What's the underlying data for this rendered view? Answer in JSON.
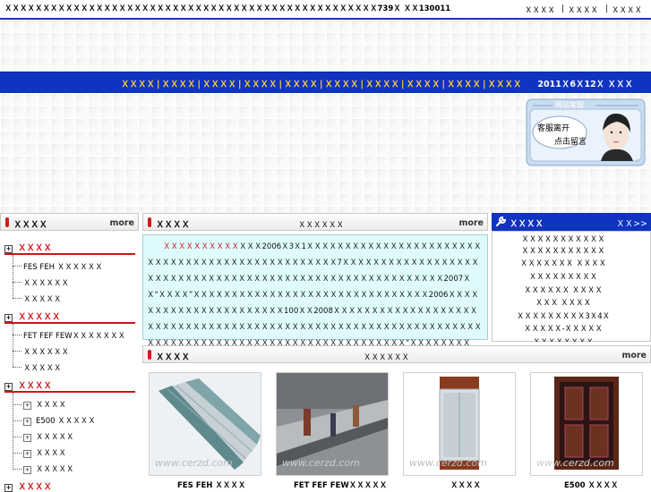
{
  "topbar": {
    "address": "ＸＸＸＸＸＸＸＸＸＸＸＸＸＸＸＸＸＸＸＸＸＸＸＸＸＸＸＸＸＸＸＸＸＸＸＸＸＸＸＸＸＸＸＸＸＸＸＸＸ739Ｘ ＸＸ130011",
    "links": [
      "ＸＸＸＸ",
      "ＸＸＸＸ",
      "ＸＸＸＸ"
    ]
  },
  "nav": {
    "items": [
      "ＸＸＸＸ",
      "ＸＸＸＸ",
      "ＸＸＸＸ",
      "ＸＸＸＸ",
      "ＸＸＸＸ",
      "ＸＸＸＸ",
      "ＸＸＸＸ",
      "ＸＸＸＸ",
      "ＸＸＸＸ",
      "ＸＸＸＸ"
    ],
    "date": "2011Ｘ6Ｘ12Ｘ ＸＸＸ"
  },
  "chat": {
    "title": "网站客服",
    "status": "客服离开",
    "action": "点击留言"
  },
  "sidebar": {
    "title": "ＸＸＸＸ",
    "more": "more",
    "categories": [
      {
        "label": "ＸＸＸＸ",
        "items": [
          "FES FEH ＸＸＸＸＸＸ",
          "ＸＸＸＸＸＸ",
          "ＸＸＸＸＸ"
        ]
      },
      {
        "label": "ＸＸＸＸＸ",
        "items": [
          "FET FEF FEWＸＸＸＸＸＸＸ",
          "ＸＸＸＸＸＸ",
          "ＸＸＸＸＸ"
        ]
      },
      {
        "label": "ＸＸＸＸ",
        "items": [
          "ＸＸＸＸ",
          "E500 ＸＸＸＸＸ",
          "ＸＸＸＸＸ",
          "ＸＸＸＸ",
          "ＸＸＸＸＸ"
        ]
      },
      {
        "label": "ＸＸＸＸ",
        "items": []
      }
    ]
  },
  "intro": {
    "title": "ＸＸＸＸ",
    "subtitle": "ＸＸＸＸＸＸ",
    "more": "more",
    "lead": "ＸＸＸＸＸＸＸＸＸＸ",
    "text": "ＸＸＸ2006Ｘ3Ｘ1ＸＸＸＸＸＸＸＸＸＸＸＸＸＸＸＸＸＸＸＸＸＸＸＸＸＸＸＸＸＸＸＸＸＸＸＸＸＸＸＸＸＸＸＸＸＸＸＸ7ＸＸＸＸＸＸＸＸＸＸＸＸＸＸＸＸＸＸＸＸＸＸＸＸＸＸＸＸＸＸＸＸＸＸＸＸＸＸＸＸＸＸＸＸＸＸＸＸＸＸＸＸＸＸＸＸＸ2007ＸＸ“ＸＸＸＸ”ＸＸＸＸＸＸＸＸＸＸＸＸＸＸＸＸＸＸＸＸＸＸＸＸＸＸＸＸＸＸＸ2006ＸＸＸＸＸＸＸＸＸＸＸＸＸＸＸＸＸＸＸＸＸＸ100ＸＸ2008ＸＸＸＸＸＸＸＸＸＸＸＸＸＸＸＸＸＸＸＸＸＸＸＸＸＸＸＸＸＸＸＸＸＸＸＸＸＸＸＸＸＸＸＸＸＸＸＸＸＸＸＸＸＸＸＸＸＸＸＸＸＸＸＸＸＸＸＸＸＸＸＸＸＸＸＸＸＸＸＸＸＸＸＸＸＸＸＸＸＸＸＸＸＸＸＸＸ“ＸＸＸＸＸＸＸＸＸ”ＸＸＸ……ＸＸＸＸ"
  },
  "service": {
    "title": "ＸＸＸＸ",
    "more": "ＸＸ>>",
    "lines": [
      "ＸＸＸＸＸＸＸＸＸＸＸ",
      "ＸＸＸＸＸＸＸＸＸＸＸ",
      "ＸＸＸＸＸＸＸ ＸＸＸＸ",
      "ＸＸＸＸＸＸＸＸＸ",
      "ＸＸＸＸＸＸ  ＸＸＸＸ",
      "ＸＸＸ ＸＸＸＸ",
      "ＸＸＸＸＸＸＸＸＸ3Ｘ4Ｘ",
      "ＸＸＸＸＸ-ＸＸＸＸＸ",
      "ＸＸＸＸＸＸＸＸ"
    ]
  },
  "products": {
    "title": "ＸＸＸＸ",
    "subtitle": "ＸＸＸＸＸＸ",
    "more": "more",
    "items": [
      {
        "caption": "FES FEH ＸＸＸＸ",
        "watermark": "www.cerzd.com"
      },
      {
        "caption": "FET FEF FEWＸＸＸＸＸ",
        "watermark": "www.cerzd.com"
      },
      {
        "caption": "ＸＸＸＸ",
        "watermark": "www.cerzd.com"
      },
      {
        "caption": "E500 ＸＸＸＸ",
        "watermark": "www.cerzd.com"
      }
    ]
  },
  "colors": {
    "nav_bg": "#1033c0",
    "nav_text": "#ffd633",
    "accent_red": "#d01010",
    "intro_bg": "#dffafc"
  }
}
